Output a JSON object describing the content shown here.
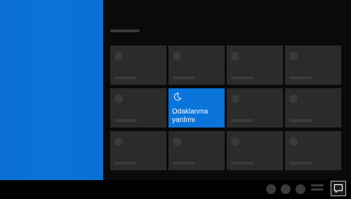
{
  "quick_actions": {
    "focus_assist": {
      "label_line1": "Odaklanma",
      "label_line2": "yardımı",
      "icon": "moon-icon",
      "state": "on"
    }
  },
  "colors": {
    "accent": "#0a74da",
    "tile_background": "#2b2b2b",
    "placeholder": "#3b3b3b",
    "panel_background": "#0a0a0a"
  },
  "taskbar": {
    "notification_icon": "action-center-icon"
  }
}
